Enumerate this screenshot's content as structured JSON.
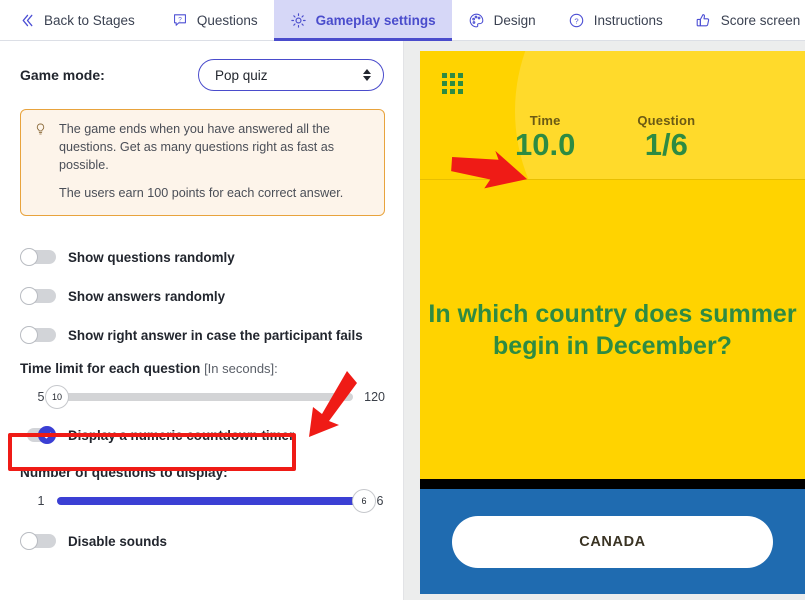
{
  "tabs": [
    {
      "label": "Back to Stages",
      "icon": "chevrons-left-icon",
      "active": false
    },
    {
      "label": "Questions",
      "icon": "question-bubble-icon",
      "active": false
    },
    {
      "label": "Gameplay settings",
      "icon": "gear-icon",
      "active": true
    },
    {
      "label": "Design",
      "icon": "palette-icon",
      "active": false
    },
    {
      "label": "Instructions",
      "icon": "question-circle-icon",
      "active": false
    },
    {
      "label": "Score screen",
      "icon": "thumbs-up-icon",
      "active": false
    }
  ],
  "settings": {
    "game_mode_label": "Game mode:",
    "game_mode_value": "Pop quiz",
    "game_mode_options": [
      "Pop quiz"
    ],
    "callout": {
      "icon": "lightbulb-icon",
      "paragraph1": "The game ends when you have answered all the questions. Get as many questions right as fast as possible.",
      "paragraph2": "The users earn 100 points for each correct answer.",
      "border_color": "#e8a33d",
      "background_color": "#fdf4ea"
    },
    "toggles": [
      {
        "label": "Show questions randomly",
        "on": false
      },
      {
        "label": "Show answers randomly",
        "on": false
      },
      {
        "label": "Show right answer in case the participant fails",
        "on": false
      }
    ],
    "time_limit": {
      "title": "Time limit for each question",
      "subtitle": "[In seconds]:",
      "min": "5",
      "max": "120",
      "value": "10",
      "fill_percent": 0
    },
    "countdown_toggle": {
      "label": "Display a numeric countdown timer",
      "on": true,
      "highlight_color": "#ef1b16",
      "accent_color": "#3b3fd4"
    },
    "num_questions": {
      "title": "Number of questions to display:",
      "min": "1",
      "max": "6",
      "value": "6",
      "fill_percent": 100,
      "fill_color": "#3b3fd4"
    },
    "disable_sounds": {
      "label": "Disable sounds",
      "on": false
    }
  },
  "preview": {
    "grid_icon": "grid-menu-icon",
    "time_caption": "Time",
    "time_value": "10.0",
    "question_caption": "Question",
    "question_value": "1/6",
    "question_text": "In which country does summer begin in December?",
    "answers": [
      "CANADA"
    ],
    "colors": {
      "background": "#ffd300",
      "accent_text": "#2e8b42",
      "answer_band": "#1f6bb0"
    }
  },
  "annotations": [
    {
      "name": "arrow-to-countdown-toggle",
      "color": "#ef1b16"
    },
    {
      "name": "arrow-to-preview-timer",
      "color": "#ef1b16"
    }
  ]
}
